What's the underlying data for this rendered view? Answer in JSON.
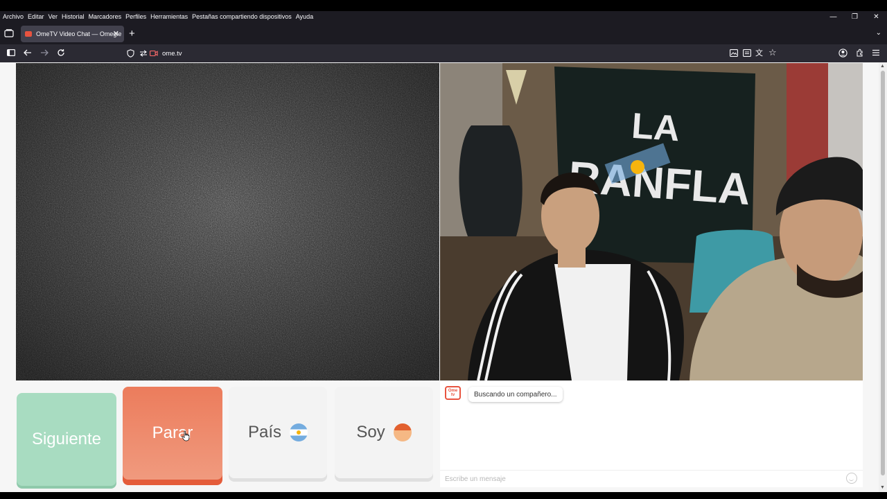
{
  "menu": {
    "items": [
      "Archivo",
      "Editar",
      "Ver",
      "Historial",
      "Marcadores",
      "Perfiles",
      "Herramientas",
      "Pestañas compartiendo dispositivos",
      "Ayuda"
    ]
  },
  "window_controls": {
    "minimize": "—",
    "restore": "❐",
    "close": "✕"
  },
  "tab": {
    "title": "OmeTV Video Chat — Omegle"
  },
  "address_bar": {
    "url": "ome.tv"
  },
  "buttons": {
    "next": "Siguiente",
    "stop": "Parar",
    "country": "País",
    "iam": "Soy"
  },
  "chat": {
    "logo": "Ome tv",
    "status_message": "Buscando un compañero...",
    "input_placeholder": "Escribe un mensaje"
  },
  "remote_video": {
    "banner_text": "LA RANFLA"
  },
  "colors": {
    "next": "#a8dcc1",
    "stop": "#ee8b6d",
    "brand": "#e8533f",
    "browser_chrome": "#1c1b22"
  },
  "icons": {
    "tab_list": "tab-list-icon",
    "back": "arrow-left-icon",
    "forward": "arrow-right-icon",
    "reload": "reload-icon",
    "shield": "shield-icon",
    "permissions": "permissions-icon",
    "camera": "camera-icon",
    "extensions": "puzzle-icon",
    "account": "account-icon",
    "menu": "hamburger-icon",
    "bookmark": "star-icon"
  }
}
